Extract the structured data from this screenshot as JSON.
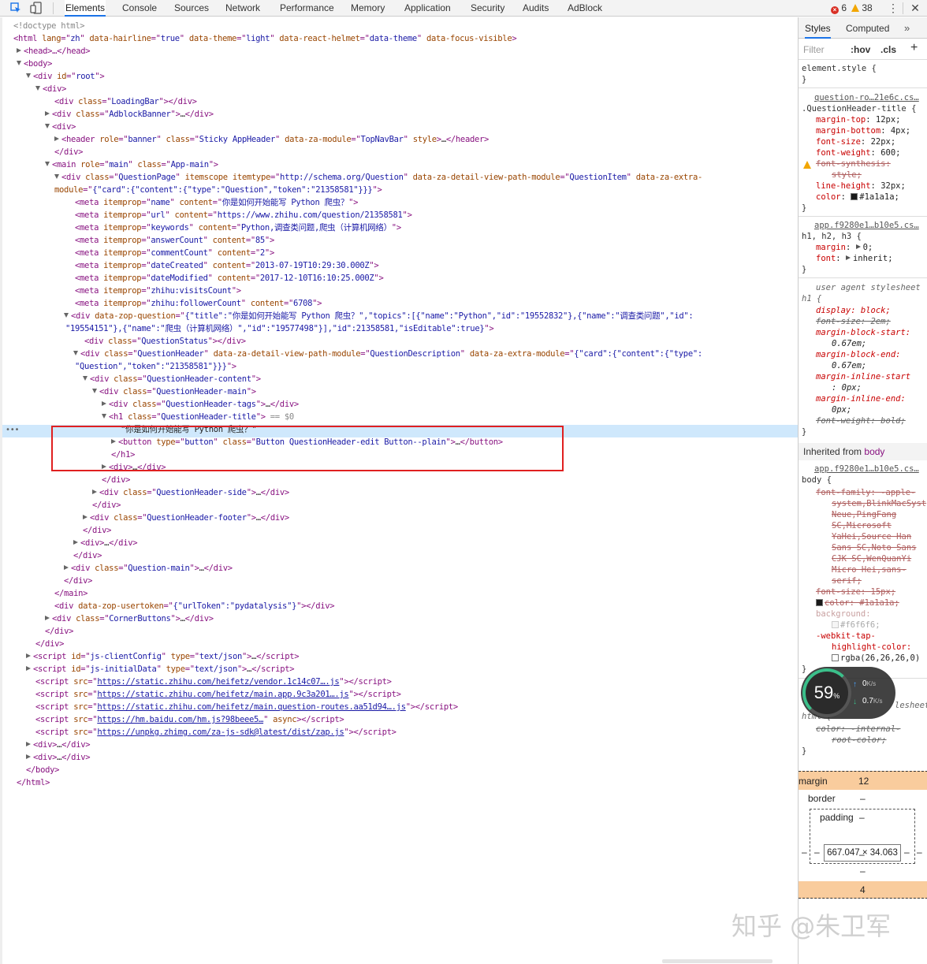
{
  "toolbar": {
    "tabs": [
      "Elements",
      "Console",
      "Sources",
      "Network",
      "Performance",
      "Memory",
      "Application",
      "Security",
      "Audits",
      "AdBlock"
    ],
    "active_tab": "Elements",
    "error_count": "6",
    "warning_count": "38"
  },
  "dom_tree": {
    "doctype": "<!doctype html>",
    "html_open": {
      "tag": "<html",
      "attrs": [
        [
          "lang",
          "zh"
        ],
        [
          "data-hairline",
          "true"
        ],
        [
          "data-theme",
          "light"
        ],
        [
          "data-react-helmet",
          "data-theme"
        ],
        [
          "data-focus-visible",
          null
        ]
      ],
      "close": ">"
    },
    "head": "<head>…</head>",
    "body_open": "<body>",
    "div_root": {
      "tag": "<div",
      "attr": "id",
      "val": "root"
    },
    "div": "<div>",
    "loadingbar": {
      "attr": "class",
      "val": "LoadingBar"
    },
    "adblock": {
      "attr": "class",
      "val": "AdblockBanner"
    },
    "header": {
      "role": "banner",
      "class": "Sticky AppHeader",
      "module": "TopNavBar",
      "style": "style"
    },
    "main": {
      "role": "main",
      "class": "App-main"
    },
    "questionpage": {
      "class": "QuestionPage",
      "itemscope": "itemscope",
      "itemtype": "http://schema.org/Question",
      "path_module": "QuestionItem",
      "extra_line1": "{\"card\":{\"content\":{\"type\":\"Question\",\"token\":\"21358581\"}}}"
    },
    "meta": [
      {
        "prop": "name",
        "content": "你是如何开始能写 Python 爬虫？"
      },
      {
        "prop": "url",
        "content": "https://www.zhihu.com/question/21358581"
      },
      {
        "prop": "keywords",
        "content": "Python,调查类问题,爬虫（计算机网络）"
      },
      {
        "prop": "answerCount",
        "content": "85"
      },
      {
        "prop": "commentCount",
        "content": "2"
      },
      {
        "prop": "dateCreated",
        "content": "2013-07-19T10:29:30.000Z"
      },
      {
        "prop": "dateModified",
        "content": "2017-12-10T16:10:25.000Z"
      },
      {
        "prop": "zhihu:visitsCount",
        "content": null
      },
      {
        "prop": "zhihu:followerCount",
        "content": "6708"
      }
    ],
    "zop_question_line1": "{\"title\":\"你是如何开始能写 Python 爬虫？\",\"topics\":[{\"name\":\"Python\",\"id\":\"19552832\"},{\"name\":\"调查类问题\",\"id\":",
    "zop_question_line2": "\"19554151\"},{\"name\":\"爬虫（计算机网络）\",\"id\":\"19577498\"}],\"id\":21358581,\"isEditable\":true}",
    "question_status": "QuestionStatus",
    "question_header": {
      "class": "QuestionHeader",
      "path_module": "QuestionDescription",
      "extra_line1": "{\"card\":{\"content\":{\"type\":",
      "extra_line2": "\"Question\",\"token\":\"21358581\"}}}"
    },
    "qh_content": "QuestionHeader-content",
    "qh_main": "QuestionHeader-main",
    "qh_tags": "QuestionHeader-tags",
    "h1_class": "QuestionHeader-title",
    "h1_eq": "== $0",
    "h1_text": "\"你是如何开始能写 Python 爬虫？\"",
    "button": {
      "type": "button",
      "class": "Button QuestionHeader-edit Button--plain"
    },
    "qh_side": "QuestionHeader-side",
    "qh_footer": "QuestionHeader-footer",
    "question_main": "Question-main",
    "usertoken": "{\"urlToken\":\"pydatalysis\"}",
    "corner_buttons": "CornerButtons",
    "scripts_json": [
      [
        "js-clientConfig",
        "text/json"
      ],
      [
        "js-initialData",
        "text/json"
      ]
    ],
    "scripts_src": [
      {
        "src": "https://static.zhihu.com/heifetz/vendor.1c14c07….js",
        "extra": ""
      },
      {
        "src": "https://static.zhihu.com/heifetz/main.app.9c3a201….js",
        "extra": ""
      },
      {
        "src": "https://static.zhihu.com/heifetz/main.question-routes.aa51d94….js",
        "extra": ""
      },
      {
        "src": "https://hm.baidu.com/hm.js?98beee5…",
        "extra": "async"
      },
      {
        "src": "https://unpkg.zhimg.com/za-js-sdk@latest/dist/zap.js",
        "extra": ""
      }
    ]
  },
  "styles": {
    "tabs": [
      "Styles",
      "Computed"
    ],
    "filter_placeholder": "Filter",
    "hov": ":hov",
    "cls": ".cls",
    "element_style": "element.style {",
    "rule1": {
      "source": "question-ro…21e6c.cs…",
      "selector": ".QuestionHeader-title {",
      "props": [
        [
          "margin-top",
          "12px;"
        ],
        [
          "margin-bottom",
          "4px;"
        ],
        [
          "font-size",
          "22px;"
        ],
        [
          "font-weight",
          "600;"
        ],
        [
          "font-synthesis",
          "style;"
        ],
        [
          "line-height",
          "32px;"
        ],
        [
          "color",
          "#1a1a1a;"
        ]
      ]
    },
    "rule2": {
      "source": "app.f9280e1…b10e5.cs…",
      "selector": "h1, h2, h3 {",
      "props": [
        [
          "margin",
          "0;"
        ],
        [
          "font",
          "inherit;"
        ]
      ]
    },
    "ua_label": "user agent stylesheet",
    "ua_rule": {
      "selector": "h1 {",
      "lines": [
        "display: block;",
        "font-size: 2em;",
        "margin-block-start:",
        "0.67em;",
        "margin-block-end:",
        "0.67em;",
        "margin-inline-start",
        ": 0px;",
        "margin-inline-end:",
        "0px;",
        "font-weight: bold;"
      ]
    },
    "inherited_label": "Inherited from",
    "inherited_from": "body",
    "body_rule": {
      "source": "app.f9280e1…b10e5.cs…",
      "selector": "body {",
      "lines": [
        "font-family: -apple-",
        "system,BlinkMacSyst",
        "Neue,PingFang",
        "SC,Microsoft",
        "YaHei,Source Han",
        "Sans SC,Noto Sans",
        "CJK SC,WenQuanYi",
        "Micro Hei,sans-",
        "serif;",
        "font-size: 15px;",
        "color: #1a1a1a;",
        "background:",
        "#f6f6f6;",
        "-webkit-tap-",
        "highlight-color:",
        "rgba(26,26,26,0)"
      ]
    },
    "html_rule": {
      "label_tail": "lesheet",
      "selector": "html {",
      "lines": [
        "color: -internal-",
        "root-color;"
      ]
    },
    "box_model": {
      "margin_label": "margin",
      "margin_top": "12",
      "border_label": "border",
      "border_val": "–",
      "padding_label": "padding",
      "padding_val": "–",
      "content": "667.047 × 34.063",
      "side": "–",
      "margin_bottom": "4"
    },
    "speed": {
      "percent": "59",
      "unit": "%",
      "up": "0",
      "up_unit": "K/s",
      "down": "0.7",
      "down_unit": "K/s"
    }
  },
  "watermark": "知乎 @朱卫军",
  "colors": {
    "accent": "#1a73e8",
    "highlight": "#cfe8fc",
    "annotation": "#e02020",
    "margin_box": "#f9cc9d"
  }
}
